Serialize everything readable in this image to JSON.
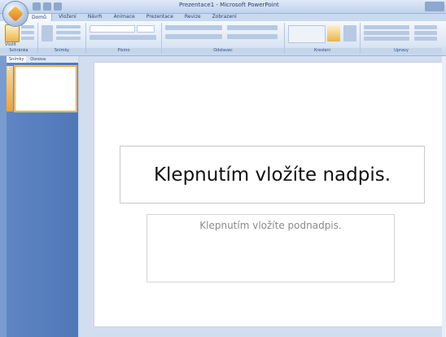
{
  "window": {
    "title": "Prezentace1 - Microsoft PowerPoint"
  },
  "tabs": [
    {
      "label": "Domů"
    },
    {
      "label": "Vložení"
    },
    {
      "label": "Návrh"
    },
    {
      "label": "Animace"
    },
    {
      "label": "Prezentace"
    },
    {
      "label": "Revize"
    },
    {
      "label": "Zobrazení"
    }
  ],
  "ribbon": {
    "paste_label": "Vložit",
    "groups": [
      {
        "label": "Schránka"
      },
      {
        "label": "Snímky"
      },
      {
        "label": "Písmo"
      },
      {
        "label": "Odstavec"
      },
      {
        "label": "Kreslení"
      },
      {
        "label": "Úpravy"
      }
    ]
  },
  "panel": {
    "tabs": [
      {
        "label": "Snímky"
      },
      {
        "label": "Osnova"
      }
    ],
    "slide_number": "1"
  },
  "slide": {
    "title_placeholder": "Klepnutím vložíte nadpis.",
    "subtitle_placeholder": "Klepnutím vložíte podnadpis."
  }
}
